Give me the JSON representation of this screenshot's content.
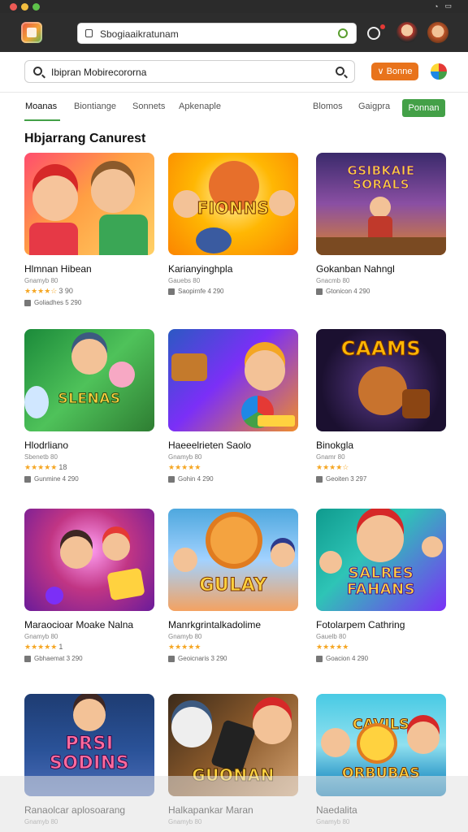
{
  "url": "Sbogiaaikratunam",
  "search": {
    "value": "Ibipran Mobirecororna"
  },
  "header_button": "Bonne",
  "tabs": [
    {
      "label": "Moanas",
      "active": true
    },
    {
      "label": "Biontiange",
      "active": false
    },
    {
      "label": "Sonnets",
      "active": false
    },
    {
      "label": "Apkenaple",
      "active": false
    },
    {
      "label": "Blomos",
      "active": false
    },
    {
      "label": "Gaigpra",
      "active": false
    }
  ],
  "cta_button": "Ponnan",
  "section_title": "Hbjarrang Canurest",
  "games": [
    {
      "name": "Hlmnan Hibean",
      "meta": "Gnamyb 80",
      "rating_text": "3 90",
      "stars": 5,
      "stats": "Goliadhes 5 290",
      "thumb_title": ""
    },
    {
      "name": "Karianyinghpla",
      "meta": "Gauebs 80",
      "rating_text": "",
      "stars": 0,
      "stats": "Saopirnfe 4 290",
      "thumb_title": "FIONNS"
    },
    {
      "name": "Gokanban Nahngl",
      "meta": "Gnacmb 80",
      "rating_text": "",
      "stars": 0,
      "stats": "Gtonicon 4 290",
      "thumb_title": "GSIBKAIE SORALS"
    },
    {
      "name": "Hlodrliano",
      "meta": "Sbenetb 80",
      "rating_text": "18",
      "stars": 5,
      "stats": "Gunmine 4 290",
      "thumb_title": "SLENAS"
    },
    {
      "name": "Haeeelrieten Saolo",
      "meta": "Gnamyb 80",
      "rating_text": "",
      "stars": 5,
      "stats": "Gohin 4 290",
      "thumb_title": ""
    },
    {
      "name": "Binokgla",
      "meta": "Gnamr 80",
      "rating_text": "",
      "stars": 5,
      "stats": "Geoiten 3 297",
      "thumb_title": "CAAMS"
    },
    {
      "name": "Maraocioar Moake Nalna",
      "meta": "Gnamyb 80",
      "rating_text": "1",
      "stars": 5,
      "stats": "Gbhaemat 3 290",
      "thumb_title": ""
    },
    {
      "name": "Manrkgrintalkadolime",
      "meta": "Gnamyb 80",
      "rating_text": "",
      "stars": 5,
      "stats": "Geoicnaris 3 290",
      "thumb_title": "GULAY"
    },
    {
      "name": "Fotolarpem Cathring",
      "meta": "Gauelb 80",
      "rating_text": "",
      "stars": 5,
      "stats": "Goacion 4 290",
      "thumb_title": "SALRES FAHANS"
    },
    {
      "name": "Ranaolcar aplosoarang",
      "meta": "Gnamyb 80",
      "rating_text": "",
      "stars": 0,
      "stats": "",
      "thumb_title": "PRSI SODINS"
    },
    {
      "name": "Halkapankar Maran",
      "meta": "Gnamyb 80",
      "rating_text": "",
      "stars": 0,
      "stats": "",
      "thumb_title": "GUONAN"
    },
    {
      "name": "Naedalita",
      "meta": "Gnamyb 80",
      "rating_text": "",
      "stars": 0,
      "stats": "",
      "thumb_title": "CAVILS ORBUBAS"
    }
  ]
}
